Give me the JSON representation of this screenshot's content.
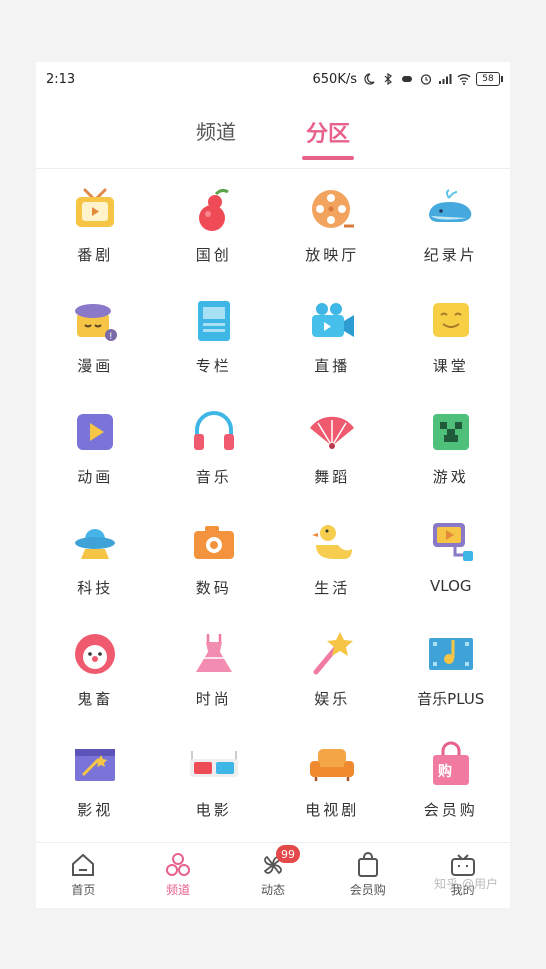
{
  "status_bar": {
    "time": "2:13",
    "speed": "650K/s",
    "battery": "58"
  },
  "tabs": [
    {
      "label": "频道",
      "active": false
    },
    {
      "label": "分区",
      "active": true
    }
  ],
  "categories": [
    {
      "label": "番剧",
      "icon": "tv-icon"
    },
    {
      "label": "国创",
      "icon": "gourd-icon"
    },
    {
      "label": "放映厅",
      "icon": "film-reel-icon"
    },
    {
      "label": "纪录片",
      "icon": "whale-icon"
    },
    {
      "label": "漫画",
      "icon": "beret-comic-icon"
    },
    {
      "label": "专栏",
      "icon": "article-icon"
    },
    {
      "label": "直播",
      "icon": "video-camera-icon"
    },
    {
      "label": "课堂",
      "icon": "smiley-board-icon"
    },
    {
      "label": "动画",
      "icon": "play-square-icon"
    },
    {
      "label": "音乐",
      "icon": "headphones-icon"
    },
    {
      "label": "舞蹈",
      "icon": "fan-icon"
    },
    {
      "label": "游戏",
      "icon": "creeper-icon"
    },
    {
      "label": "科技",
      "icon": "ufo-icon"
    },
    {
      "label": "数码",
      "icon": "camera-icon"
    },
    {
      "label": "生活",
      "icon": "duck-icon"
    },
    {
      "label": "VLOG",
      "icon": "vlog-camera-icon"
    },
    {
      "label": "鬼畜",
      "icon": "clown-icon"
    },
    {
      "label": "时尚",
      "icon": "dress-icon"
    },
    {
      "label": "娱乐",
      "icon": "magic-wand-icon"
    },
    {
      "label": "音乐PLUS",
      "icon": "music-note-icon"
    },
    {
      "label": "影视",
      "icon": "clapper-icon"
    },
    {
      "label": "电影",
      "icon": "3d-glasses-icon"
    },
    {
      "label": "电视剧",
      "icon": "sofa-icon"
    },
    {
      "label": "会员购",
      "icon": "shopping-bag-icon"
    }
  ],
  "bottom_nav": [
    {
      "label": "首页",
      "icon": "home-icon",
      "active": false
    },
    {
      "label": "频道",
      "icon": "channel-icon",
      "active": true
    },
    {
      "label": "动态",
      "icon": "pinwheel-icon",
      "active": false,
      "badge": "99"
    },
    {
      "label": "会员购",
      "icon": "bag-icon",
      "active": false
    },
    {
      "label": "我的",
      "icon": "tv-face-icon",
      "active": false
    }
  ],
  "watermark": "知乎 @用户",
  "colors": {
    "accent": "#e7618b",
    "badge": "#e54848"
  }
}
